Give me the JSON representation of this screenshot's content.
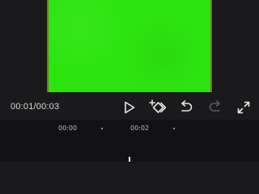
{
  "player": {
    "timecode": "00:01/00:03",
    "frame_color": "#2ce50f"
  },
  "toolbar": {
    "play_icon": "play-icon",
    "keyframe_icon": "add-keyframe-icon",
    "undo_icon": "undo-icon",
    "redo_icon": "redo-icon",
    "fullscreen_icon": "fullscreen-icon"
  },
  "timeline": {
    "ticks": [
      "00:00",
      "00:02"
    ]
  }
}
